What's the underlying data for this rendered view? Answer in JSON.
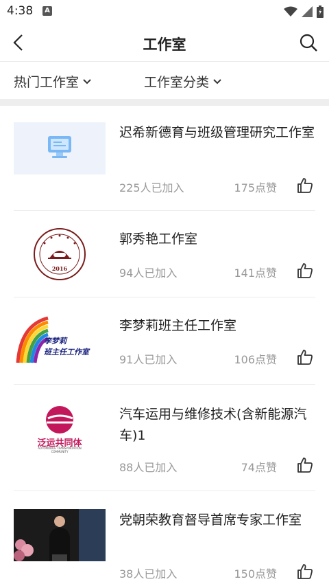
{
  "status": {
    "time": "4:38",
    "notification": "A"
  },
  "header": {
    "title": "工作室"
  },
  "filters": [
    {
      "label": "热门工作室"
    },
    {
      "label": "工作室分类"
    }
  ],
  "studios": [
    {
      "title": "迟希新德育与班级管理研究工作室",
      "members": "225人已加入",
      "likes": "175点赞",
      "thumb": "monitor-icon"
    },
    {
      "title": "郭秀艳工作室",
      "members": "94人已加入",
      "likes": "141点赞",
      "thumb": "seal-logo",
      "logo_text": "2016"
    },
    {
      "title": "李梦莉班主任工作室",
      "members": "91人已加入",
      "likes": "106点赞",
      "thumb": "rainbow-logo",
      "logo_text_1": "李梦莉",
      "logo_text_2": "班主任工作室"
    },
    {
      "title": "汽车运用与维修技术(含新能源汽车)1",
      "members": "88人已加入",
      "likes": "74点赞",
      "thumb": "car-logo",
      "logo_text_1": "泛运共同体",
      "logo_text_2": "AUTOMOBILE TRANSPORTATION COMMUNITY"
    },
    {
      "title": "党朝荣教育督导首席专家工作室",
      "members": "38人已加入",
      "likes": "150点赞",
      "thumb": "speaker-photo"
    }
  ]
}
